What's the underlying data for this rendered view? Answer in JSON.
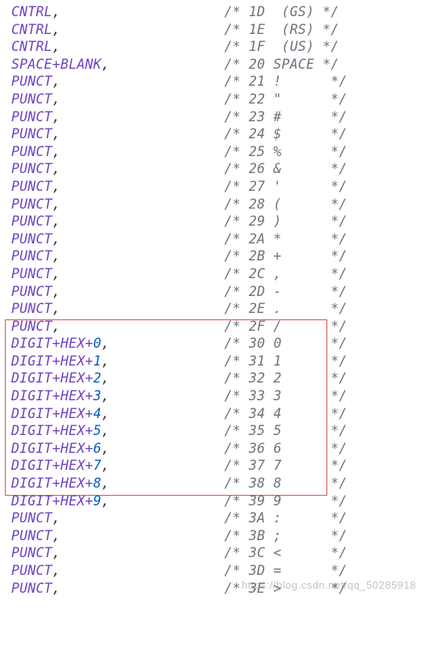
{
  "watermark": "https://blog.csdn.net/qq_50285918",
  "lines": [
    {
      "tokens": [
        {
          "cls": "ident",
          "t": "CNTRL"
        }
      ],
      "comma": true,
      "cpad": 20,
      "chex": "1D",
      "ctxt": "(GS)",
      "cgap": 2,
      "cpost": 0
    },
    {
      "tokens": [
        {
          "cls": "ident",
          "t": "CNTRL"
        }
      ],
      "comma": true,
      "cpad": 20,
      "chex": "1E",
      "ctxt": "(RS)",
      "cgap": 2,
      "cpost": 0
    },
    {
      "tokens": [
        {
          "cls": "ident",
          "t": "CNTRL"
        }
      ],
      "comma": true,
      "cpad": 20,
      "chex": "1F",
      "ctxt": "(US)",
      "cgap": 2,
      "cpost": 0
    },
    {
      "tokens": [
        {
          "cls": "ident",
          "t": "SPACE"
        },
        {
          "cls": "plus",
          "t": "+"
        },
        {
          "cls": "ident",
          "t": "BLANK"
        }
      ],
      "comma": true,
      "cpad": 14,
      "chex": "20",
      "ctxt": "SPACE",
      "cgap": 1,
      "cpost": 0
    },
    {
      "tokens": [
        {
          "cls": "ident",
          "t": "PUNCT"
        }
      ],
      "comma": true,
      "cpad": 20,
      "chex": "21",
      "ctxt": "!",
      "cgap": 1,
      "cpost": 5
    },
    {
      "tokens": [
        {
          "cls": "ident",
          "t": "PUNCT"
        }
      ],
      "comma": true,
      "cpad": 20,
      "chex": "22",
      "ctxt": "\"",
      "cgap": 1,
      "cpost": 5
    },
    {
      "tokens": [
        {
          "cls": "ident",
          "t": "PUNCT"
        }
      ],
      "comma": true,
      "cpad": 20,
      "chex": "23",
      "ctxt": "#",
      "cgap": 1,
      "cpost": 5
    },
    {
      "tokens": [
        {
          "cls": "ident",
          "t": "PUNCT"
        }
      ],
      "comma": true,
      "cpad": 20,
      "chex": "24",
      "ctxt": "$",
      "cgap": 1,
      "cpost": 5
    },
    {
      "tokens": [
        {
          "cls": "ident",
          "t": "PUNCT"
        }
      ],
      "comma": true,
      "cpad": 20,
      "chex": "25",
      "ctxt": "%",
      "cgap": 1,
      "cpost": 5
    },
    {
      "tokens": [
        {
          "cls": "ident",
          "t": "PUNCT"
        }
      ],
      "comma": true,
      "cpad": 20,
      "chex": "26",
      "ctxt": "&",
      "cgap": 1,
      "cpost": 5
    },
    {
      "tokens": [
        {
          "cls": "ident",
          "t": "PUNCT"
        }
      ],
      "comma": true,
      "cpad": 20,
      "chex": "27",
      "ctxt": "'",
      "cgap": 1,
      "cpost": 5
    },
    {
      "tokens": [
        {
          "cls": "ident",
          "t": "PUNCT"
        }
      ],
      "comma": true,
      "cpad": 20,
      "chex": "28",
      "ctxt": "(",
      "cgap": 1,
      "cpost": 5
    },
    {
      "tokens": [
        {
          "cls": "ident",
          "t": "PUNCT"
        }
      ],
      "comma": true,
      "cpad": 20,
      "chex": "29",
      "ctxt": ")",
      "cgap": 1,
      "cpost": 5
    },
    {
      "tokens": [
        {
          "cls": "ident",
          "t": "PUNCT"
        }
      ],
      "comma": true,
      "cpad": 20,
      "chex": "2A",
      "ctxt": "*",
      "cgap": 1,
      "cpost": 5
    },
    {
      "tokens": [
        {
          "cls": "ident",
          "t": "PUNCT"
        }
      ],
      "comma": true,
      "cpad": 20,
      "chex": "2B",
      "ctxt": "+",
      "cgap": 1,
      "cpost": 5
    },
    {
      "tokens": [
        {
          "cls": "ident",
          "t": "PUNCT"
        }
      ],
      "comma": true,
      "cpad": 20,
      "chex": "2C",
      "ctxt": ",",
      "cgap": 1,
      "cpost": 5
    },
    {
      "tokens": [
        {
          "cls": "ident",
          "t": "PUNCT"
        }
      ],
      "comma": true,
      "cpad": 20,
      "chex": "2D",
      "ctxt": "-",
      "cgap": 1,
      "cpost": 5
    },
    {
      "tokens": [
        {
          "cls": "ident",
          "t": "PUNCT"
        }
      ],
      "comma": true,
      "cpad": 20,
      "chex": "2E",
      "ctxt": ".",
      "cgap": 1,
      "cpost": 5
    },
    {
      "tokens": [
        {
          "cls": "ident",
          "t": "PUNCT"
        }
      ],
      "comma": true,
      "cpad": 20,
      "chex": "2F",
      "ctxt": "/",
      "cgap": 1,
      "cpost": 5
    },
    {
      "tokens": [
        {
          "cls": "ident",
          "t": "DIGIT"
        },
        {
          "cls": "plus",
          "t": "+"
        },
        {
          "cls": "ident",
          "t": "HEX"
        },
        {
          "cls": "plus",
          "t": "+"
        },
        {
          "cls": "num",
          "t": "0"
        }
      ],
      "comma": true,
      "cpad": 14,
      "chex": "30",
      "ctxt": "0",
      "cgap": 1,
      "cpost": 5
    },
    {
      "tokens": [
        {
          "cls": "ident",
          "t": "DIGIT"
        },
        {
          "cls": "plus",
          "t": "+"
        },
        {
          "cls": "ident",
          "t": "HEX"
        },
        {
          "cls": "plus",
          "t": "+"
        },
        {
          "cls": "num",
          "t": "1"
        }
      ],
      "comma": true,
      "cpad": 14,
      "chex": "31",
      "ctxt": "1",
      "cgap": 1,
      "cpost": 5
    },
    {
      "tokens": [
        {
          "cls": "ident",
          "t": "DIGIT"
        },
        {
          "cls": "plus",
          "t": "+"
        },
        {
          "cls": "ident",
          "t": "HEX"
        },
        {
          "cls": "plus",
          "t": "+"
        },
        {
          "cls": "num",
          "t": "2"
        }
      ],
      "comma": true,
      "cpad": 14,
      "chex": "32",
      "ctxt": "2",
      "cgap": 1,
      "cpost": 5
    },
    {
      "tokens": [
        {
          "cls": "ident",
          "t": "DIGIT"
        },
        {
          "cls": "plus",
          "t": "+"
        },
        {
          "cls": "ident",
          "t": "HEX"
        },
        {
          "cls": "plus",
          "t": "+"
        },
        {
          "cls": "num",
          "t": "3"
        }
      ],
      "comma": true,
      "cpad": 14,
      "chex": "33",
      "ctxt": "3",
      "cgap": 1,
      "cpost": 5
    },
    {
      "tokens": [
        {
          "cls": "ident",
          "t": "DIGIT"
        },
        {
          "cls": "plus",
          "t": "+"
        },
        {
          "cls": "ident",
          "t": "HEX"
        },
        {
          "cls": "plus",
          "t": "+"
        },
        {
          "cls": "num",
          "t": "4"
        }
      ],
      "comma": true,
      "cpad": 14,
      "chex": "34",
      "ctxt": "4",
      "cgap": 1,
      "cpost": 5
    },
    {
      "tokens": [
        {
          "cls": "ident",
          "t": "DIGIT"
        },
        {
          "cls": "plus",
          "t": "+"
        },
        {
          "cls": "ident",
          "t": "HEX"
        },
        {
          "cls": "plus",
          "t": "+"
        },
        {
          "cls": "num",
          "t": "5"
        }
      ],
      "comma": true,
      "cpad": 14,
      "chex": "35",
      "ctxt": "5",
      "cgap": 1,
      "cpost": 5
    },
    {
      "tokens": [
        {
          "cls": "ident",
          "t": "DIGIT"
        },
        {
          "cls": "plus",
          "t": "+"
        },
        {
          "cls": "ident",
          "t": "HEX"
        },
        {
          "cls": "plus",
          "t": "+"
        },
        {
          "cls": "num",
          "t": "6"
        }
      ],
      "comma": true,
      "cpad": 14,
      "chex": "36",
      "ctxt": "6",
      "cgap": 1,
      "cpost": 5
    },
    {
      "tokens": [
        {
          "cls": "ident",
          "t": "DIGIT"
        },
        {
          "cls": "plus",
          "t": "+"
        },
        {
          "cls": "ident",
          "t": "HEX"
        },
        {
          "cls": "plus",
          "t": "+"
        },
        {
          "cls": "num",
          "t": "7"
        }
      ],
      "comma": true,
      "cpad": 14,
      "chex": "37",
      "ctxt": "7",
      "cgap": 1,
      "cpost": 5
    },
    {
      "tokens": [
        {
          "cls": "ident",
          "t": "DIGIT"
        },
        {
          "cls": "plus",
          "t": "+"
        },
        {
          "cls": "ident",
          "t": "HEX"
        },
        {
          "cls": "plus",
          "t": "+"
        },
        {
          "cls": "num",
          "t": "8"
        }
      ],
      "comma": true,
      "cpad": 14,
      "chex": "38",
      "ctxt": "8",
      "cgap": 1,
      "cpost": 5
    },
    {
      "tokens": [
        {
          "cls": "ident",
          "t": "DIGIT"
        },
        {
          "cls": "plus",
          "t": "+"
        },
        {
          "cls": "ident",
          "t": "HEX"
        },
        {
          "cls": "plus",
          "t": "+"
        },
        {
          "cls": "num",
          "t": "9"
        }
      ],
      "comma": true,
      "cpad": 14,
      "chex": "39",
      "ctxt": "9",
      "cgap": 1,
      "cpost": 5
    },
    {
      "tokens": [
        {
          "cls": "ident",
          "t": "PUNCT"
        }
      ],
      "comma": true,
      "cpad": 20,
      "chex": "3A",
      "ctxt": ":",
      "cgap": 1,
      "cpost": 5
    },
    {
      "tokens": [
        {
          "cls": "ident",
          "t": "PUNCT"
        }
      ],
      "comma": true,
      "cpad": 20,
      "chex": "3B",
      "ctxt": ";",
      "cgap": 1,
      "cpost": 5
    },
    {
      "tokens": [
        {
          "cls": "ident",
          "t": "PUNCT"
        }
      ],
      "comma": true,
      "cpad": 20,
      "chex": "3C",
      "ctxt": "<",
      "cgap": 1,
      "cpost": 5
    },
    {
      "tokens": [
        {
          "cls": "ident",
          "t": "PUNCT"
        }
      ],
      "comma": true,
      "cpad": 20,
      "chex": "3D",
      "ctxt": "=",
      "cgap": 1,
      "cpost": 5
    },
    {
      "tokens": [
        {
          "cls": "ident",
          "t": "PUNCT"
        }
      ],
      "comma": true,
      "cpad": 20,
      "chex": "3E",
      "ctxt": ">",
      "cgap": 1,
      "cpost": 5
    }
  ]
}
